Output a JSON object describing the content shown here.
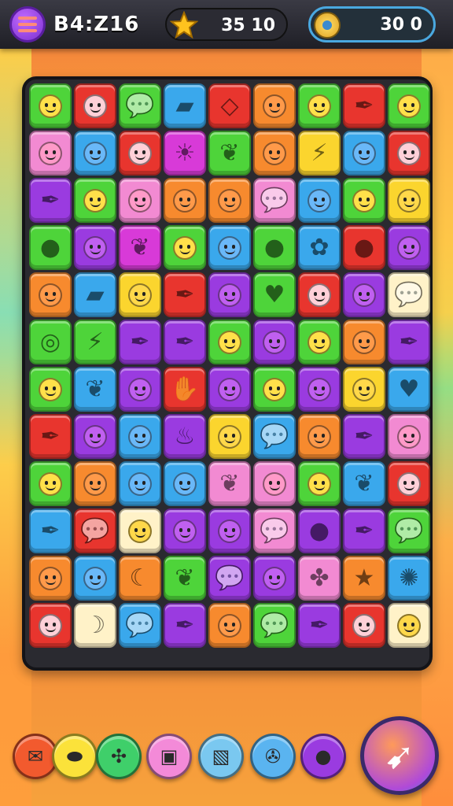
{
  "header": {
    "player_name": "B4:Z16",
    "star_value": "35 10",
    "timer_value": "30 0"
  },
  "icons": {
    "menu": "menu-icon",
    "star": "star-icon",
    "clock": "clock-icon"
  },
  "board": {
    "rows": [
      [
        [
          "green",
          "face"
        ],
        [
          "red",
          "face"
        ],
        [
          "green",
          "bubble"
        ],
        [
          "blue",
          "eraser"
        ],
        [
          "red",
          "square"
        ],
        [
          "orange",
          "face"
        ],
        [
          "green",
          "face"
        ],
        [
          "red",
          "feather"
        ],
        [
          "green",
          "face"
        ]
      ],
      [
        [
          "pink",
          "face"
        ],
        [
          "blue",
          "face"
        ],
        [
          "red",
          "face"
        ],
        [
          "magenta",
          "sun"
        ],
        [
          "green",
          "leaf"
        ],
        [
          "orange",
          "face"
        ],
        [
          "yellow",
          "bolt"
        ],
        [
          "blue",
          "face"
        ],
        [
          "red",
          "face"
        ]
      ],
      [
        [
          "purple",
          "feather"
        ],
        [
          "green",
          "face"
        ],
        [
          "pink",
          "face"
        ],
        [
          "orange",
          "face"
        ],
        [
          "orange",
          "face"
        ],
        [
          "pink",
          "bubble"
        ],
        [
          "blue",
          "face"
        ],
        [
          "green",
          "face"
        ],
        [
          "yellow",
          "face"
        ]
      ],
      [
        [
          "green",
          "apple"
        ],
        [
          "purple",
          "face"
        ],
        [
          "magenta",
          "leaf"
        ],
        [
          "green",
          "face"
        ],
        [
          "blue",
          "face"
        ],
        [
          "green",
          "dot"
        ],
        [
          "blue",
          "mask"
        ],
        [
          "red",
          "dot"
        ],
        [
          "purple",
          "face"
        ]
      ],
      [
        [
          "orange",
          "face"
        ],
        [
          "blue",
          "eraser"
        ],
        [
          "yellow",
          "face"
        ],
        [
          "red",
          "feather"
        ],
        [
          "purple",
          "face"
        ],
        [
          "green",
          "heart"
        ],
        [
          "red",
          "face"
        ],
        [
          "purple",
          "face"
        ],
        [
          "cream",
          "bubble"
        ]
      ],
      [
        [
          "green",
          "donut"
        ],
        [
          "green",
          "bolt"
        ],
        [
          "purple",
          "feather"
        ],
        [
          "purple",
          "feather"
        ],
        [
          "green",
          "face"
        ],
        [
          "purple",
          "face"
        ],
        [
          "green",
          "face"
        ],
        [
          "orange",
          "face"
        ],
        [
          "purple",
          "feather"
        ]
      ],
      [
        [
          "green",
          "face"
        ],
        [
          "blue",
          "leaf"
        ],
        [
          "purple",
          "face"
        ],
        [
          "red",
          "hand"
        ],
        [
          "purple",
          "face"
        ],
        [
          "green",
          "face"
        ],
        [
          "purple",
          "face"
        ],
        [
          "yellow",
          "face"
        ],
        [
          "blue",
          "heart"
        ]
      ],
      [
        [
          "red",
          "feather"
        ],
        [
          "purple",
          "face"
        ],
        [
          "blue",
          "face"
        ],
        [
          "purple",
          "cup"
        ],
        [
          "yellow",
          "face"
        ],
        [
          "blue",
          "bubble"
        ],
        [
          "orange",
          "face"
        ],
        [
          "purple",
          "feather"
        ],
        [
          "pink",
          "face"
        ]
      ],
      [
        [
          "green",
          "face"
        ],
        [
          "orange",
          "face"
        ],
        [
          "blue",
          "face"
        ],
        [
          "blue",
          "face"
        ],
        [
          "pink",
          "leaf"
        ],
        [
          "pink",
          "face"
        ],
        [
          "green",
          "face"
        ],
        [
          "blue",
          "leaf"
        ],
        [
          "red",
          "face"
        ]
      ],
      [
        [
          "blue",
          "feather"
        ],
        [
          "red",
          "bubble"
        ],
        [
          "cream",
          "face"
        ],
        [
          "purple",
          "face"
        ],
        [
          "purple",
          "face"
        ],
        [
          "pink",
          "bubble"
        ],
        [
          "purple",
          "apple"
        ],
        [
          "purple",
          "feather"
        ],
        [
          "green",
          "bubble"
        ]
      ],
      [
        [
          "orange",
          "face"
        ],
        [
          "blue",
          "face"
        ],
        [
          "orange",
          "moon"
        ],
        [
          "green",
          "leaf"
        ],
        [
          "purple",
          "bubble"
        ],
        [
          "purple",
          "face"
        ],
        [
          "pink",
          "clover"
        ],
        [
          "orange",
          "star"
        ],
        [
          "blue",
          "splat"
        ]
      ],
      [
        [
          "red",
          "face"
        ],
        [
          "cream",
          "banana"
        ],
        [
          "blue",
          "bubble"
        ],
        [
          "purple",
          "feather"
        ],
        [
          "orange",
          "face"
        ],
        [
          "green",
          "bubble"
        ],
        [
          "purple",
          "feather"
        ],
        [
          "red",
          "face"
        ],
        [
          "cream",
          "face"
        ]
      ]
    ]
  },
  "colors": {
    "green": "#4ed43a",
    "red": "#e8352e",
    "blue": "#3aa8ec",
    "orange": "#f78a2e",
    "yellow": "#fbd52e",
    "purple": "#9a3be0",
    "pink": "#f28ad2",
    "magenta": "#d83ad8",
    "cream": "#fff2c8"
  },
  "boosters": [
    {
      "name": "envelope-booster",
      "color": "#f25a2e",
      "icon": "✉"
    },
    {
      "name": "bean-booster",
      "color": "#fbe23a",
      "icon": "⬬"
    },
    {
      "name": "clover-booster",
      "color": "#3fcf6a",
      "icon": "✣"
    },
    {
      "name": "gift-booster",
      "color": "#f38ad8",
      "icon": "▣"
    },
    {
      "name": "map-booster",
      "color": "#7ac8f0",
      "icon": "▧"
    },
    {
      "name": "compass-booster",
      "color": "#5ab4f0",
      "icon": "✇"
    },
    {
      "name": "bomb-booster",
      "color": "#9a3be0",
      "icon": "●"
    }
  ],
  "action_icon": "hammer-sound-icon"
}
